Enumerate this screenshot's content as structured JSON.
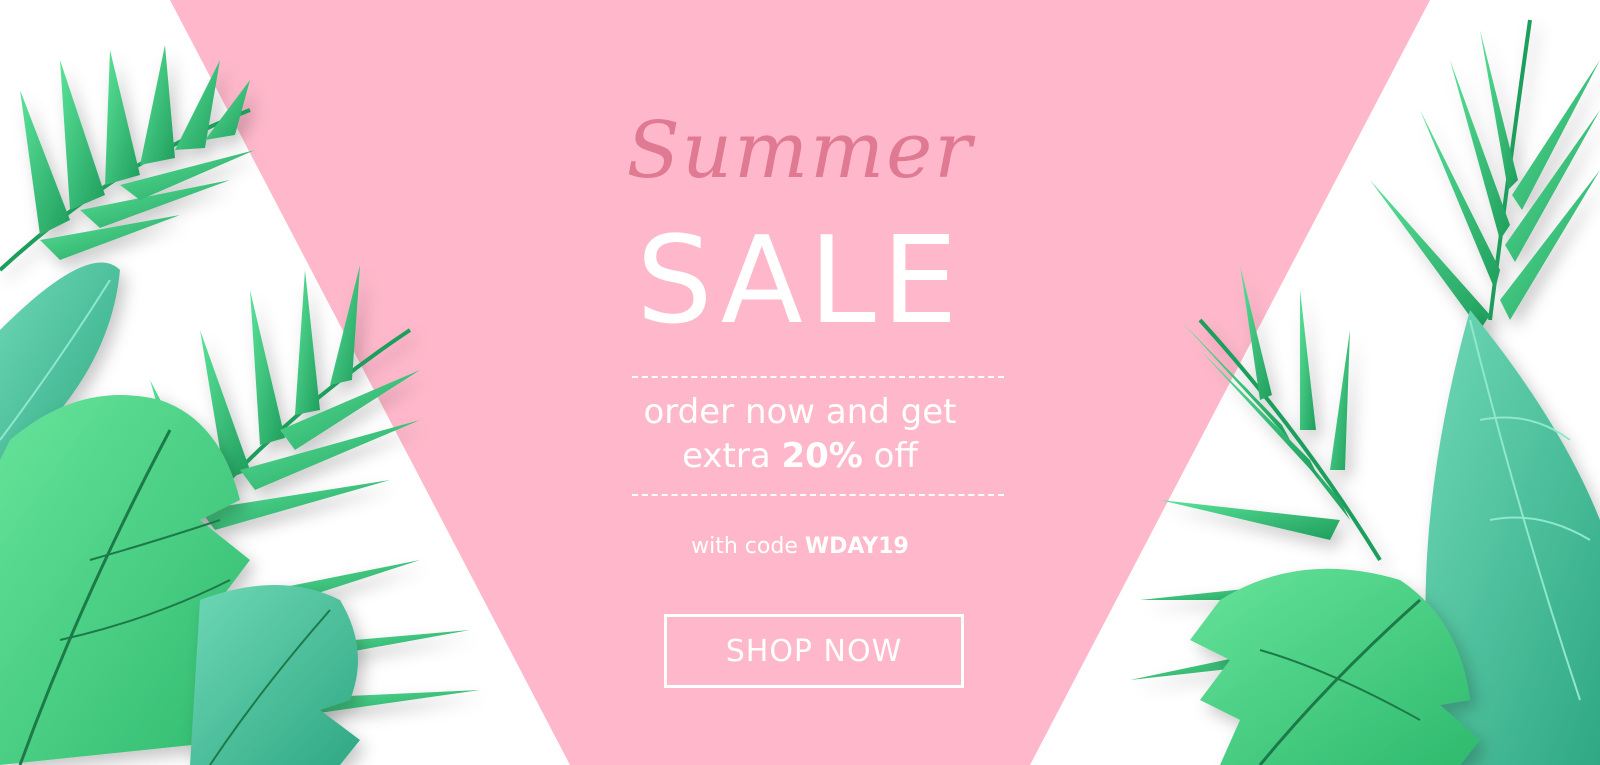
{
  "banner": {
    "script_word": "Summer",
    "main_word": "SALE",
    "offer_line1": "order now and get",
    "offer_line2_prefix": "extra ",
    "offer_line2_highlight": "20%",
    "offer_line2_suffix": " off",
    "code_prefix": "with code ",
    "code_value": "WDAY19",
    "button_label": "SHOP NOW"
  },
  "colors": {
    "pink_panel": "#ffb8cb",
    "script_pink": "#e07a92",
    "leaf_green": "#3ccf7a",
    "leaf_dark": "#1f9e5c",
    "leaf_teal": "#4fc7a3",
    "white": "#ffffff"
  }
}
